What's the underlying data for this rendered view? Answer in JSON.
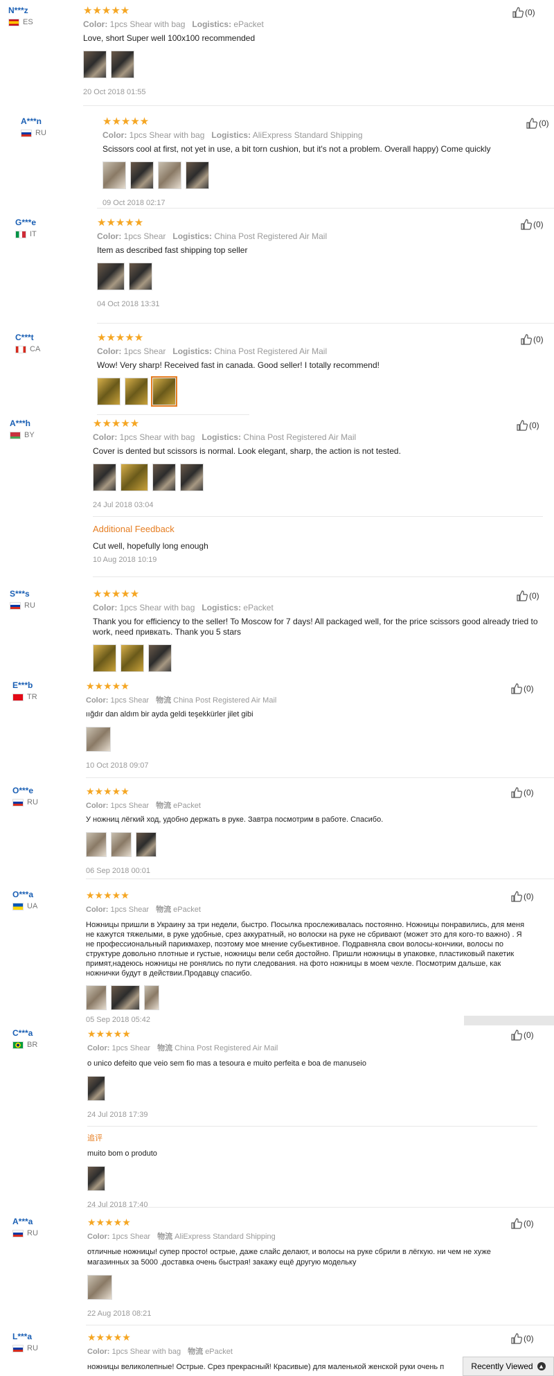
{
  "reviews": [
    {
      "user": "N***z",
      "country": "ES",
      "flag": "#c60b1e",
      "stars": "★★★★★",
      "meta_k1": "Color:",
      "meta_v1": "1pcs Shear with bag",
      "meta_k2": "Logistics:",
      "meta_v2": "ePacket",
      "text": "Love, short Super well 100x100 recommended",
      "date": "20 Oct 2018 01:55",
      "likes": "(0)"
    },
    {
      "user": "A***n",
      "country": "RU",
      "flag": "#0039a6",
      "stars": "★★★★★",
      "meta_k1": "Color:",
      "meta_v1": "1pcs Shear with bag",
      "meta_k2": "Logistics:",
      "meta_v2": "AliExpress Standard Shipping",
      "text": "Scissors cool at first, not yet in use, a bit torn cushion, but it's not a problem. Overall happy) Come quickly",
      "date": "09 Oct 2018 02:17",
      "likes": "(0)"
    },
    {
      "user": "G***e",
      "country": "IT",
      "flag": "#009246",
      "stars": "★★★★★",
      "meta_k1": "Color:",
      "meta_v1": "1pcs Shear",
      "meta_k2": "Logistics:",
      "meta_v2": "China Post Registered Air Mail",
      "text": "Item as described fast shipping top seller",
      "date": "04 Oct 2018 13:31",
      "likes": "(0)"
    },
    {
      "user": "C***t",
      "country": "CA",
      "flag": "#d52b1e",
      "stars": "★★★★★",
      "meta_k1": "Color:",
      "meta_v1": "1pcs Shear",
      "meta_k2": "Logistics:",
      "meta_v2": "China Post Registered Air Mail",
      "text": "Wow! Very sharp! Received fast in canada. Good seller! I totally recommend!",
      "date": "",
      "likes": "(0)"
    },
    {
      "user": "A***h",
      "country": "BY",
      "flag": "#c8313e",
      "stars": "★★★★★",
      "meta_k1": "Color:",
      "meta_v1": "1pcs Shear with bag",
      "meta_k2": "Logistics:",
      "meta_v2": "China Post Registered Air Mail",
      "text": "Cover is dented but scissors is normal. Look elegant, sharp, the action is not tested.",
      "date": "24 Jul 2018 03:04",
      "likes": "(0)",
      "additional_label": "Additional Feedback",
      "additional_text": "Cut well, hopefully long enough",
      "additional_date": "10 Aug 2018 10:19"
    },
    {
      "user": "S***s",
      "country": "RU",
      "flag": "#0039a6",
      "stars": "★★★★★",
      "meta_k1": "Color:",
      "meta_v1": "1pcs Shear with bag",
      "meta_k2": "Logistics:",
      "meta_v2": "ePacket",
      "text": "Thank you for efficiency to the seller! To Moscow for 7 days! All packaged well, for the price scissors good already tried to work, need привкать. Thank you 5 stars",
      "date": "",
      "likes": "(0)"
    },
    {
      "user": "E***b",
      "country": "TR",
      "flag": "#e30a17",
      "stars": "★★★★★",
      "meta_k1": "Color:",
      "meta_v1": "1pcs Shear",
      "meta_k2": "物流",
      "meta_v2": "China Post Registered Air Mail",
      "text": "ıığdır dan aldım bir ayda geldi teşekkürler jilet gibi",
      "date": "10 Oct 2018 09:07",
      "likes": "(0)"
    },
    {
      "user": "O***e",
      "country": "RU",
      "flag": "#0039a6",
      "stars": "★★★★★",
      "meta_k1": "Color:",
      "meta_v1": "1pcs Shear",
      "meta_k2": "物流",
      "meta_v2": "ePacket",
      "text": "У ножниц лёгкий ход, удобно держать в руке. Завтра посмотрим в работе. Спасибо.",
      "date": "06 Sep 2018 00:01",
      "likes": "(0)"
    },
    {
      "user": "O***a",
      "country": "UA",
      "flag": "#0057b7",
      "stars": "★★★★★",
      "meta_k1": "Color:",
      "meta_v1": "1pcs Shear",
      "meta_k2": "物流",
      "meta_v2": "ePacket",
      "text": "Ножницы пришли в Украину за три недели, быстро. Посылка прослеживалась постоянно. Ножницы понравились, для меня не кажутся тяжелыми, в руке удобные, срез аккуратный, но волоски на руке не сбривают (может это для кого-то важно) . Я не профессиональный парикмахер, поэтому мое мнение субьективное. Подравняла свои волосы-кончики, волосы по структуре довольно плотные и густые, ножницы вели себя достойно. Пришли ножницы в упаковке, пластиковый пакетик примят,надеюсь ножницы не ронялись по пути следования. на фото ножницы в моем чехле. Посмотрим дальше, как ножнички будут в действии.Продавцу спасибо.",
      "date": "05 Sep 2018 05:42",
      "likes": "(0)"
    },
    {
      "user": "C***a",
      "country": "BR",
      "flag": "#009c3b",
      "stars": "★★★★★",
      "meta_k1": "Color:",
      "meta_v1": "1pcs Shear",
      "meta_k2": "物流",
      "meta_v2": "China Post Registered Air Mail",
      "text": "o unico defeito que veio sem fio mas a tesoura e muito perfeita e boa de manuseio",
      "date": "24 Jul 2018 17:39",
      "likes": "(0)",
      "additional_label": "追评",
      "additional_text": "muito bom o produto",
      "additional_date": "24 Jul 2018 17:40"
    },
    {
      "user": "A***a",
      "country": "RU",
      "flag": "#0039a6",
      "stars": "★★★★★",
      "meta_k1": "Color:",
      "meta_v1": "1pcs Shear",
      "meta_k2": "物流",
      "meta_v2": "AliExpress Standard Shipping",
      "text": "отличные ножницы! супер просто! острые, даже слайс делают, и волосы на руке сбрили в лёгкую. ни чем не хуже магазинных за 5000 .доставка очень быстрая! закажу ещё другую модельку",
      "date": "22 Aug 2018 08:21",
      "likes": "(0)"
    },
    {
      "user": "L***a",
      "country": "RU",
      "flag": "#0039a6",
      "stars": "★★★★★",
      "meta_k1": "Color:",
      "meta_v1": "1pcs Shear with bag",
      "meta_k2": "物流",
      "meta_v2": "ePacket",
      "text": "ножницы великолепные! Острые. Срез прекрасный! Красивые) для маленькой женской руки очень п",
      "date": "",
      "likes": "(0)"
    }
  ],
  "recently_viewed": "Recently Viewed",
  "recently_viewed_icon": "chevron-up-icon"
}
